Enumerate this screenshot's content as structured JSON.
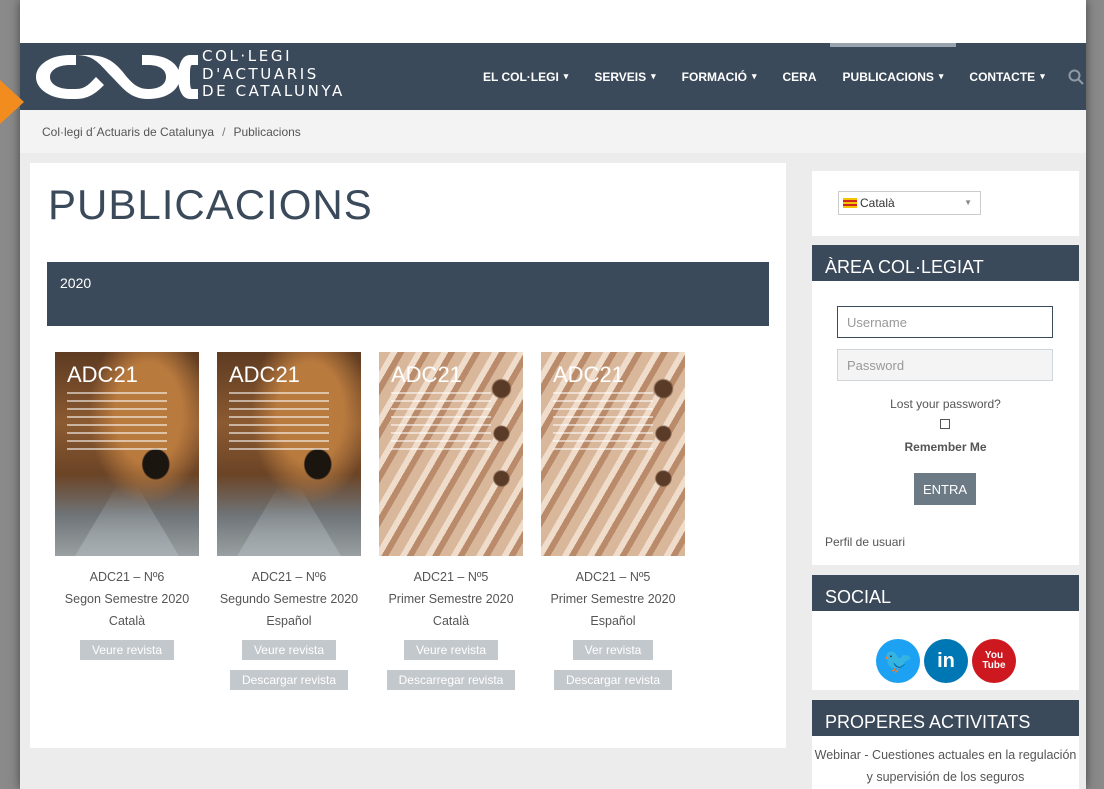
{
  "logo": {
    "mark": "cac",
    "line1": "COL·LEGI",
    "line2": "D'ACTUARIS",
    "line3": "DE CATALUNYA"
  },
  "nav": {
    "items": [
      {
        "label": "EL COL·LEGI",
        "caret": "▾"
      },
      {
        "label": "SERVEIS",
        "caret": "▾"
      },
      {
        "label": "FORMACIÓ",
        "caret": "▾"
      },
      {
        "label": "CERA",
        "caret": ""
      },
      {
        "label": "PUBLICACIONS",
        "caret": "▾"
      },
      {
        "label": "CONTACTE",
        "caret": "▾"
      }
    ],
    "active": "PUBLICACIONS",
    "search_icon": "magnifier-icon"
  },
  "breadcrumb": {
    "home": "Col·legi d´Actuaris de Catalunya",
    "separator": "/",
    "current": "Publicacions"
  },
  "page": {
    "title": "PUBLICACIONS",
    "year": "2020"
  },
  "magazines": [
    {
      "cover_title": "ADC21",
      "title": "ADC21 – Nº6",
      "subtitle": "Segon Semestre 2020",
      "lang": "Català",
      "btn1": "Veure revista",
      "btn2": ""
    },
    {
      "cover_title": "ADC21",
      "title": "ADC21 – Nº6",
      "subtitle": "Segundo Semestre 2020",
      "lang": "Español",
      "btn1": "Veure revista",
      "btn2": "Descargar revista"
    },
    {
      "cover_title": "ADC21",
      "title": "ADC21 – Nº5",
      "subtitle": "Primer Semestre 2020",
      "lang": "Català",
      "btn1": "Veure revista",
      "btn2": "Descarregar revista"
    },
    {
      "cover_title": "ADC21",
      "title": "ADC21 – Nº5",
      "subtitle": "Primer Semestre 2020",
      "lang": "Español",
      "btn1": "Ver revista",
      "btn2": "Descargar revista"
    }
  ],
  "sidebar": {
    "language": {
      "selected": "Català"
    },
    "area": {
      "heading": "ÀREA COL·LEGIAT",
      "username_placeholder": "Username",
      "password_placeholder": "Password",
      "lost_password": "Lost your password?",
      "remember": "Remember Me",
      "submit": "ENTRA",
      "profile": "Perfil de usuari"
    },
    "social": {
      "heading": "SOCIAL",
      "twitter_glyph": "🐦",
      "linkedin_glyph": "in",
      "youtube_line1": "You",
      "youtube_line2": "Tube"
    },
    "activities": {
      "heading": "PROPERES ACTIVITATS",
      "item": "Webinar - Cuestiones actuales en la regulación y supervisión de los seguros"
    }
  },
  "colors": {
    "nav_bg": "#3b4a5a",
    "accent_orange": "#f28c1f",
    "button_grey": "#c3c8cd"
  }
}
